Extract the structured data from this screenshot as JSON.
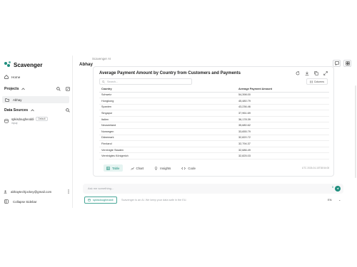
{
  "app": {
    "name": "Scavenger",
    "accent": "#1f8e7e"
  },
  "sidebar": {
    "home_label": "Home",
    "projects_label": "Projects",
    "project_item": "Abhay",
    "data_sources_label": "Data Sources",
    "data_source": {
      "name": "spkisdougheoddi",
      "badge": "Default",
      "sub": "mysql"
    },
    "user_email": "abhaytechjockey@gmail.com",
    "collapse_label": "Collapse Sidebar"
  },
  "header": {
    "breadcrumb": "Scavenger AI",
    "title": "Abhay"
  },
  "card": {
    "title": "Average Payment Amount by Country from Customers and Payments",
    "search_placeholder": "Search...",
    "columns_label": "Columns",
    "columns": [
      "Country",
      "Average Payment Amount"
    ],
    "rows": [
      [
        "Schweiz",
        "54,398.00"
      ],
      [
        "Hongkong",
        "45,480.79"
      ],
      [
        "Spanien",
        "43,236.46"
      ],
      [
        "Singapur",
        "37,961.69"
      ],
      [
        "Italien",
        "36,178.39"
      ],
      [
        "Neuseeland",
        "35,680.62"
      ],
      [
        "Norwegen",
        "33,655.79"
      ],
      [
        "Dänemark",
        "32,820.72"
      ],
      [
        "Finnland",
        "32,794.37"
      ],
      [
        "Vereinigte Staaten",
        "32,686.49"
      ],
      [
        "Vereinigtes Königreich",
        "32,825.03"
      ]
    ],
    "tabs": {
      "table": "Table",
      "chart": "Chart",
      "insights": "Insights",
      "code": "Code"
    },
    "footer": "UTC 2026-04-16T08:54:08"
  },
  "composer": {
    "placeholder": "Ask me something...",
    "credit": "0",
    "datasource_chip": "spkisdougheoddi",
    "disclaimer": "Scavenger is an AI. We keep your data safe in the EU.",
    "language": "EN",
    "language_caret": "⌄"
  },
  "icons": [
    "scavenger-logo-icon",
    "home-icon",
    "chevron-up-icon",
    "search-icon",
    "edit-icon",
    "folder-icon",
    "database-icon",
    "user-icon",
    "more-icon",
    "collapse-icon",
    "refresh-icon",
    "download-icon",
    "copy-icon",
    "expand-icon",
    "columns-icon",
    "table-icon",
    "chart-icon",
    "lightbulb-icon",
    "code-icon",
    "send-icon",
    "chat-icon",
    "layout-icon"
  ]
}
